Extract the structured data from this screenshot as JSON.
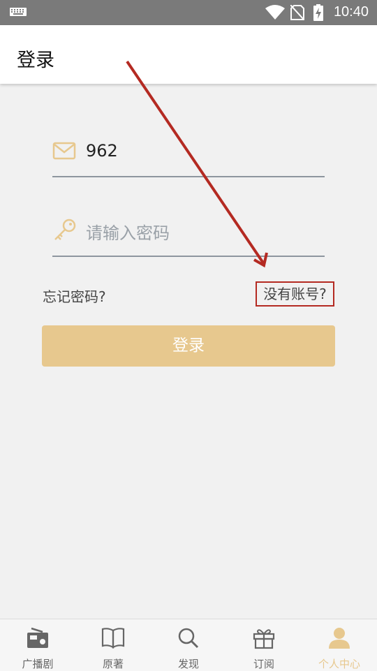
{
  "status_bar": {
    "time": "10:40"
  },
  "header": {
    "title": "登录"
  },
  "form": {
    "email_value": "962",
    "password_placeholder": "请输入密码",
    "forgot_label": "忘记密码?",
    "signup_label": "没有账号?",
    "login_label": "登录"
  },
  "tabs": [
    {
      "label": "广播剧",
      "icon": "radio-icon"
    },
    {
      "label": "原著",
      "icon": "book-icon"
    },
    {
      "label": "发现",
      "icon": "search-icon"
    },
    {
      "label": "订阅",
      "icon": "gift-icon"
    },
    {
      "label": "个人中心",
      "icon": "user-icon",
      "active": true
    }
  ],
  "colors": {
    "accent": "#e7c88e",
    "annotation": "#b42a22"
  }
}
